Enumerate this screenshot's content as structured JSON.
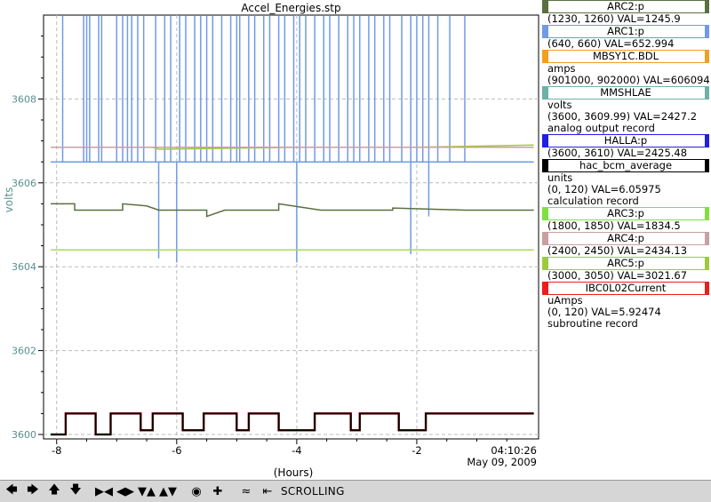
{
  "chart_data": {
    "type": "line",
    "title": "Accel_Energies.stp",
    "ylabel": "volts",
    "xlabel": "(Hours)",
    "xlim": [
      -8.1,
      -0.0
    ],
    "ylim": [
      3599.8,
      3610
    ],
    "x_ticks": [
      -8,
      -6,
      -4,
      -2
    ],
    "x_tick_labels": [
      "-8",
      "-6",
      "-4",
      "-2"
    ],
    "y_ticks": [
      3600,
      3602,
      3604,
      3606,
      3608
    ],
    "y_tick_labels": [
      "3600",
      "3602",
      "3604",
      "3606",
      "3608"
    ],
    "grid": true,
    "time_label": "04:10:26",
    "date_label": "May 09, 2009",
    "series": [
      {
        "name": "ARC1:p",
        "color": "#6f9ae8",
        "baseline": 3606.5,
        "spikes_top": [
          -7.9,
          -7.55,
          -7.5,
          -7.45,
          -7.3,
          -7.25,
          -7.0,
          -6.9,
          -6.82,
          -6.75,
          -6.65,
          -6.55,
          -6.35,
          -6.2,
          -6.1,
          -5.95,
          -5.85,
          -5.7,
          -5.6,
          -5.5,
          -5.4,
          -5.25,
          -5.1,
          -5.0,
          -4.95,
          -4.8,
          -4.7,
          -4.55,
          -4.45,
          -4.3,
          -4.2,
          -4.05,
          -3.95,
          -3.85,
          -3.7,
          -3.55,
          -3.45,
          -3.3,
          -3.15,
          -3.05,
          -2.95,
          -2.8,
          -2.7,
          -2.55,
          -2.45,
          -2.25,
          -2.1,
          -2.0,
          -1.9,
          -1.8,
          -1.65,
          -1.45,
          -1.2
        ],
        "spikes_down": [
          {
            "x": -6.3,
            "y": 3604.2
          },
          {
            "x": -6.0,
            "y": 3604.1
          },
          {
            "x": -4.0,
            "y": 3604.1
          },
          {
            "x": -2.1,
            "y": 3604.3
          },
          {
            "x": -1.8,
            "y": 3605.2
          }
        ]
      },
      {
        "name": "ARC5:p",
        "color": "#9ccc3c",
        "points": [
          [
            -8.1,
            3606.85
          ],
          [
            -6.4,
            3606.85
          ],
          [
            -6.3,
            3606.8
          ],
          [
            -4.0,
            3606.85
          ],
          [
            -2.0,
            3606.85
          ],
          [
            -0.05,
            3606.9
          ]
        ]
      },
      {
        "name": "ARC4:p",
        "color": "#c8a0a0",
        "points": [
          [
            -8.1,
            3606.85
          ],
          [
            -0.05,
            3606.85
          ]
        ]
      },
      {
        "name": "ARC3:p",
        "color": "#a8d85a",
        "points": [
          [
            -8.1,
            3604.4
          ],
          [
            -0.05,
            3604.4
          ]
        ]
      },
      {
        "name": "hac_bcm_average",
        "color": "#5a7040",
        "points": [
          [
            -8.1,
            3605.5
          ],
          [
            -7.7,
            3605.5
          ],
          [
            -7.7,
            3605.35
          ],
          [
            -6.9,
            3605.35
          ],
          [
            -6.9,
            3605.5
          ],
          [
            -6.5,
            3605.45
          ],
          [
            -6.3,
            3605.35
          ],
          [
            -5.5,
            3605.35
          ],
          [
            -5.5,
            3605.2
          ],
          [
            -5.2,
            3605.35
          ],
          [
            -4.3,
            3605.35
          ],
          [
            -4.3,
            3605.5
          ],
          [
            -3.6,
            3605.35
          ],
          [
            -2.4,
            3605.35
          ],
          [
            -2.4,
            3605.4
          ],
          [
            -1.2,
            3605.35
          ],
          [
            -0.05,
            3605.35
          ]
        ]
      },
      {
        "name": "IBC0L02Current",
        "color": "#e8201c",
        "points": [
          [
            -8.1,
            3600
          ],
          [
            -7.85,
            3600
          ],
          [
            -7.85,
            3600.5
          ],
          [
            -7.35,
            3600.5
          ],
          [
            -7.35,
            3600
          ],
          [
            -7.1,
            3600
          ],
          [
            -7.1,
            3600.5
          ],
          [
            -6.6,
            3600.5
          ],
          [
            -6.6,
            3600.1
          ],
          [
            -6.4,
            3600.1
          ],
          [
            -6.4,
            3600.5
          ],
          [
            -5.9,
            3600.5
          ],
          [
            -5.9,
            3600.1
          ],
          [
            -5.55,
            3600.1
          ],
          [
            -5.55,
            3600.5
          ],
          [
            -5.0,
            3600.5
          ],
          [
            -5.0,
            3600.1
          ],
          [
            -4.8,
            3600.1
          ],
          [
            -4.8,
            3600.5
          ],
          [
            -4.3,
            3600.5
          ],
          [
            -4.3,
            3600.1
          ],
          [
            -3.7,
            3600.1
          ],
          [
            -3.7,
            3600.5
          ],
          [
            -3.1,
            3600.5
          ],
          [
            -3.1,
            3600.1
          ],
          [
            -2.95,
            3600.1
          ],
          [
            -2.95,
            3600.5
          ],
          [
            -2.3,
            3600.5
          ],
          [
            -2.3,
            3600.1
          ],
          [
            -1.85,
            3600.1
          ],
          [
            -1.85,
            3600.5
          ],
          [
            -0.05,
            3600.5
          ]
        ]
      },
      {
        "name": "HALLA:p",
        "color": "#000000",
        "points": [
          [
            -8.1,
            3600
          ],
          [
            -7.85,
            3600
          ],
          [
            -7.85,
            3600.5
          ],
          [
            -7.35,
            3600.5
          ],
          [
            -7.35,
            3600
          ],
          [
            -7.1,
            3600
          ],
          [
            -7.1,
            3600.5
          ],
          [
            -6.6,
            3600.5
          ],
          [
            -6.6,
            3600.1
          ],
          [
            -6.4,
            3600.1
          ],
          [
            -6.4,
            3600.5
          ],
          [
            -5.9,
            3600.5
          ],
          [
            -5.9,
            3600.1
          ],
          [
            -5.55,
            3600.1
          ],
          [
            -5.55,
            3600.5
          ],
          [
            -5.0,
            3600.5
          ],
          [
            -5.0,
            3600.1
          ],
          [
            -4.8,
            3600.1
          ],
          [
            -4.8,
            3600.5
          ],
          [
            -4.3,
            3600.5
          ],
          [
            -4.3,
            3600.1
          ],
          [
            -3.7,
            3600.1
          ],
          [
            -3.7,
            3600.5
          ],
          [
            -3.1,
            3600.5
          ],
          [
            -3.1,
            3600.1
          ],
          [
            -2.95,
            3600.1
          ],
          [
            -2.95,
            3600.5
          ],
          [
            -2.3,
            3600.5
          ],
          [
            -2.3,
            3600.1
          ],
          [
            -1.85,
            3600.1
          ],
          [
            -1.85,
            3600.5
          ],
          [
            -0.05,
            3600.5
          ]
        ]
      }
    ]
  },
  "legend": [
    {
      "name": "ARC2:p",
      "color": "#5a7040",
      "lines": [
        "(1230, 1260) VAL=1245.9"
      ]
    },
    {
      "name": "ARC1:p",
      "color": "#6f9ae8",
      "lines": [
        "(640, 660) VAL=652.994"
      ]
    },
    {
      "name": "MBSY1C.BDL",
      "color": "#f0a020",
      "lines": [
        "amps",
        "(901000, 902000) VAL=606094"
      ]
    },
    {
      "name": "MMSHLAE",
      "color": "#70b0a8",
      "lines": [
        "volts",
        "(3600, 3609.99) VAL=2427.2",
        "analog output record"
      ]
    },
    {
      "name": "HALLA:p",
      "color": "#2020e0",
      "lines": [
        "(3600, 3610) VAL=2425.48"
      ]
    },
    {
      "name": "hac_bcm_average",
      "color": "#000000",
      "lines": [
        "units",
        "(0, 120) VAL=6.05975",
        "calculation record"
      ]
    },
    {
      "name": "ARC3:p",
      "color": "#80e040",
      "lines": [
        "(1800, 1850) VAL=1834.5"
      ]
    },
    {
      "name": "ARC4:p",
      "color": "#c8a0a0",
      "lines": [
        "(2400, 2450) VAL=2434.13"
      ]
    },
    {
      "name": "ARC5:p",
      "color": "#9ccc3c",
      "lines": [
        "(3000, 3050) VAL=3021.67"
      ]
    },
    {
      "name": "IBC0L02Current",
      "color": "#e8201c",
      "lines": [
        "uAmps",
        "(0, 120) VAL=5.92474",
        "subroutine record"
      ]
    }
  ],
  "toolbar": {
    "buttons": [
      "pan-left",
      "pan-right",
      "pan-up",
      "pan-down",
      "zoom-in-x",
      "zoom-out-x",
      "zoom-in-y",
      "zoom-out-y",
      "zoom-reset",
      "add-pv",
      "autoscale",
      "scroll-back"
    ],
    "status": "SCROLLING"
  }
}
